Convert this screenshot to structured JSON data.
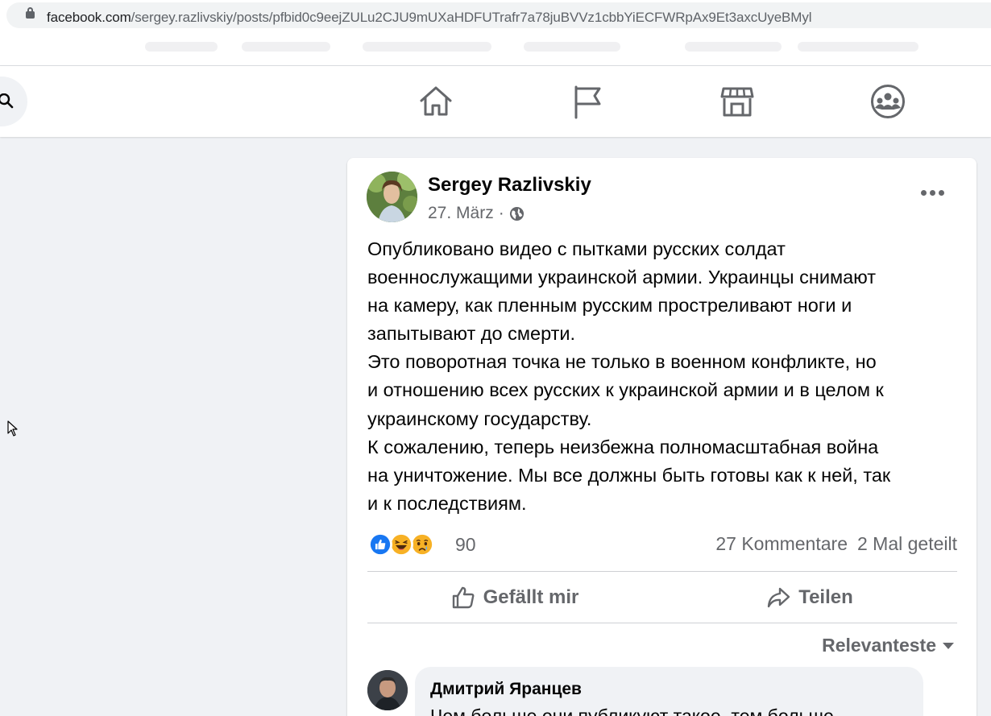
{
  "browser": {
    "url_domain": "facebook.com",
    "url_path": "/sergey.razlivskiy/posts/pfbid0c9eejZULu2CJU9mUXaHDFUTrafr7a78juBVVz1cbbYiECFWRpAx9Et3axcUyeBMyl"
  },
  "nav": {
    "icons": [
      "search-icon",
      "home-icon",
      "flag-icon",
      "marketplace-icon",
      "groups-icon"
    ]
  },
  "post": {
    "author": "Sergey Razlivskiy",
    "date": "27. März",
    "separator": "·",
    "privacy_icon": "globe-icon",
    "text_lines": [
      "Опубликовано видео с пытками русских солдат",
      "военнослужащими украинской армии. Украинцы снимают",
      "на камеру, как пленным русским простреливают ноги и",
      "запытывают до смерти.",
      "Это поворотная точка не только в военном конфликте, но",
      "и отношению всех русских к украинской армии и в целом к",
      "украинскому государству.",
      "К сожалению, теперь неизбежна полномасштабная война",
      "на уничтожение. Мы все должны быть готовы как к ней, так",
      "и к последствиям."
    ],
    "reactions": [
      "like-reaction-icon",
      "haha-reaction-icon",
      "sad-reaction-icon"
    ],
    "reaction_count": "90",
    "comments": "27 Kommentare",
    "shares": "2 Mal geteilt",
    "like_label": "Gefällt mir",
    "share_label": "Teilen",
    "sort_label": "Relevanteste"
  },
  "comment": {
    "author": "Дмитрий Яранцев",
    "text": "Чем больше они публикуют такое, тем больше"
  },
  "colors": {
    "secondary_text": "#65676b",
    "like_blue": "#1877f2",
    "haha_yellow": "#f7b125"
  }
}
